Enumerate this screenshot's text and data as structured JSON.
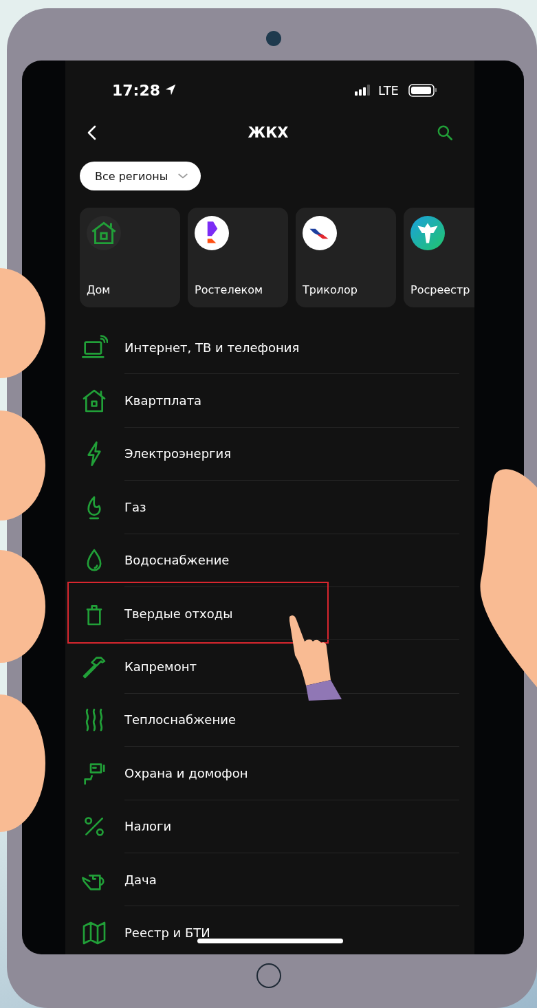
{
  "status_bar": {
    "time": "17:28",
    "network": "LTE"
  },
  "header": {
    "title": "ЖКХ"
  },
  "region_filter": {
    "label": "Все регионы"
  },
  "providers": [
    {
      "name": "Дом",
      "kind": "home"
    },
    {
      "name": "Ростелеком",
      "kind": "rostelecom"
    },
    {
      "name": "Триколор",
      "kind": "tricolor"
    },
    {
      "name": "Росреестр",
      "kind": "rosreestr"
    }
  ],
  "categories": [
    {
      "label": "Интернет, ТВ и телефония",
      "kind": "laptop",
      "highlighted": false
    },
    {
      "label": "Квартплата",
      "kind": "house",
      "highlighted": false
    },
    {
      "label": "Электроэнергия",
      "kind": "bolt",
      "highlighted": false
    },
    {
      "label": "Газ",
      "kind": "flame",
      "highlighted": false
    },
    {
      "label": "Водоснабжение",
      "kind": "drop",
      "highlighted": false
    },
    {
      "label": "Твердые отходы",
      "kind": "trash",
      "highlighted": true
    },
    {
      "label": "Капремонт",
      "kind": "hammer",
      "highlighted": false
    },
    {
      "label": "Теплоснабжение",
      "kind": "heat",
      "highlighted": false
    },
    {
      "label": "Охрана и домофон",
      "kind": "camera",
      "highlighted": false
    },
    {
      "label": "Налоги",
      "kind": "percent",
      "highlighted": false
    },
    {
      "label": "Дача",
      "kind": "can",
      "highlighted": false
    },
    {
      "label": "Реестр и БТИ",
      "kind": "map",
      "highlighted": false
    }
  ]
}
